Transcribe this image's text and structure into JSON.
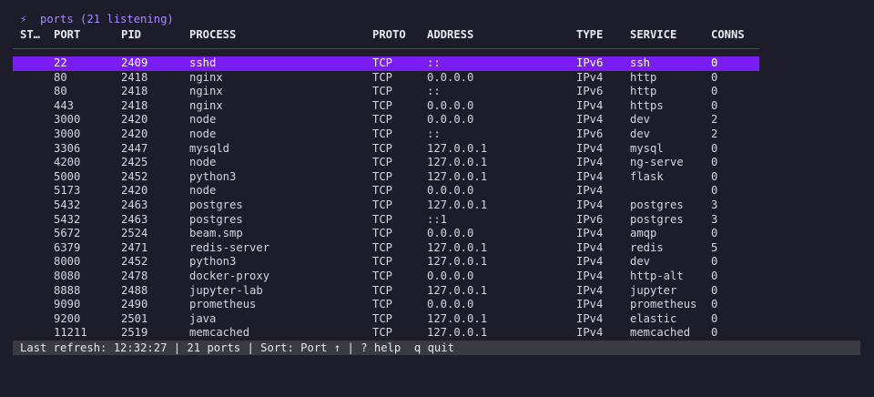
{
  "title": {
    "icon": "lightning-bolt-icon",
    "glyph": "⚡",
    "text": "ports (21 listening)"
  },
  "columns": {
    "state": "ST…",
    "port": "PORT",
    "pid": "PID",
    "process": "PROCESS",
    "proto": "PROTO",
    "address": "ADDRESS",
    "type": "TYPE",
    "service": "SERVICE",
    "conns": "CONNS"
  },
  "colors": {
    "accent": "#a98bff",
    "selection": "#7a1df0",
    "background": "#1c1c2a",
    "status_bar": "#3a3a40"
  },
  "selected_index": 0,
  "rows": [
    {
      "port": "22",
      "pid": "2409",
      "process": "sshd",
      "proto": "TCP",
      "address": "::",
      "type": "IPv6",
      "service": "ssh",
      "conns": "0"
    },
    {
      "port": "80",
      "pid": "2418",
      "process": "nginx",
      "proto": "TCP",
      "address": "0.0.0.0",
      "type": "IPv4",
      "service": "http",
      "conns": "0"
    },
    {
      "port": "80",
      "pid": "2418",
      "process": "nginx",
      "proto": "TCP",
      "address": "::",
      "type": "IPv6",
      "service": "http",
      "conns": "0"
    },
    {
      "port": "443",
      "pid": "2418",
      "process": "nginx",
      "proto": "TCP",
      "address": "0.0.0.0",
      "type": "IPv4",
      "service": "https",
      "conns": "0"
    },
    {
      "port": "3000",
      "pid": "2420",
      "process": "node",
      "proto": "TCP",
      "address": "0.0.0.0",
      "type": "IPv4",
      "service": "dev",
      "conns": "2"
    },
    {
      "port": "3000",
      "pid": "2420",
      "process": "node",
      "proto": "TCP",
      "address": "::",
      "type": "IPv6",
      "service": "dev",
      "conns": "2"
    },
    {
      "port": "3306",
      "pid": "2447",
      "process": "mysqld",
      "proto": "TCP",
      "address": "127.0.0.1",
      "type": "IPv4",
      "service": "mysql",
      "conns": "0"
    },
    {
      "port": "4200",
      "pid": "2425",
      "process": "node",
      "proto": "TCP",
      "address": "127.0.0.1",
      "type": "IPv4",
      "service": "ng-serve",
      "conns": "0"
    },
    {
      "port": "5000",
      "pid": "2452",
      "process": "python3",
      "proto": "TCP",
      "address": "127.0.0.1",
      "type": "IPv4",
      "service": "flask",
      "conns": "0"
    },
    {
      "port": "5173",
      "pid": "2420",
      "process": "node",
      "proto": "TCP",
      "address": "0.0.0.0",
      "type": "IPv4",
      "service": "",
      "conns": "0"
    },
    {
      "port": "5432",
      "pid": "2463",
      "process": "postgres",
      "proto": "TCP",
      "address": "127.0.0.1",
      "type": "IPv4",
      "service": "postgres",
      "conns": "3"
    },
    {
      "port": "5432",
      "pid": "2463",
      "process": "postgres",
      "proto": "TCP",
      "address": "::1",
      "type": "IPv6",
      "service": "postgres",
      "conns": "3"
    },
    {
      "port": "5672",
      "pid": "2524",
      "process": "beam.smp",
      "proto": "TCP",
      "address": "0.0.0.0",
      "type": "IPv4",
      "service": "amqp",
      "conns": "0"
    },
    {
      "port": "6379",
      "pid": "2471",
      "process": "redis-server",
      "proto": "TCP",
      "address": "127.0.0.1",
      "type": "IPv4",
      "service": "redis",
      "conns": "5"
    },
    {
      "port": "8000",
      "pid": "2452",
      "process": "python3",
      "proto": "TCP",
      "address": "127.0.0.1",
      "type": "IPv4",
      "service": "dev",
      "conns": "0"
    },
    {
      "port": "8080",
      "pid": "2478",
      "process": "docker-proxy",
      "proto": "TCP",
      "address": "0.0.0.0",
      "type": "IPv4",
      "service": "http-alt",
      "conns": "0"
    },
    {
      "port": "8888",
      "pid": "2488",
      "process": "jupyter-lab",
      "proto": "TCP",
      "address": "127.0.0.1",
      "type": "IPv4",
      "service": "jupyter",
      "conns": "0"
    },
    {
      "port": "9090",
      "pid": "2490",
      "process": "prometheus",
      "proto": "TCP",
      "address": "0.0.0.0",
      "type": "IPv4",
      "service": "prometheus",
      "conns": "0"
    },
    {
      "port": "9200",
      "pid": "2501",
      "process": "java",
      "proto": "TCP",
      "address": "127.0.0.1",
      "type": "IPv4",
      "service": "elastic",
      "conns": "0"
    },
    {
      "port": "11211",
      "pid": "2519",
      "process": "memcached",
      "proto": "TCP",
      "address": "127.0.0.1",
      "type": "IPv4",
      "service": "memcached",
      "conns": "0"
    }
  ],
  "status_bar": {
    "text": "Last refresh: 12:32:27 | 21 ports | Sort: Port ↑ | ? help  q quit"
  }
}
